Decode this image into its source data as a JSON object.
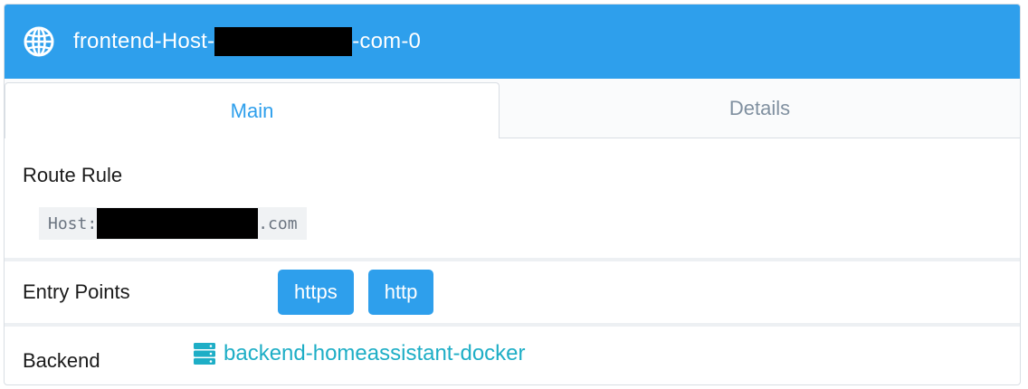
{
  "header": {
    "icon": "globe-icon",
    "title_prefix": "frontend-Host-",
    "title_suffix": "-com-0"
  },
  "tabs": [
    {
      "label": "Main",
      "active": true
    },
    {
      "label": "Details",
      "active": false
    }
  ],
  "route_rule": {
    "label": "Route Rule",
    "code_prefix": "Host:",
    "code_suffix": ".com"
  },
  "entry_points": {
    "label": "Entry Points",
    "items": [
      "https",
      "http"
    ]
  },
  "backend": {
    "label": "Backend",
    "icon": "server-icon",
    "name": "backend-homeassistant-docker"
  },
  "colors": {
    "accent": "#2e9fec",
    "link": "#1eaec6",
    "inactive_tab": "#8090a0"
  }
}
